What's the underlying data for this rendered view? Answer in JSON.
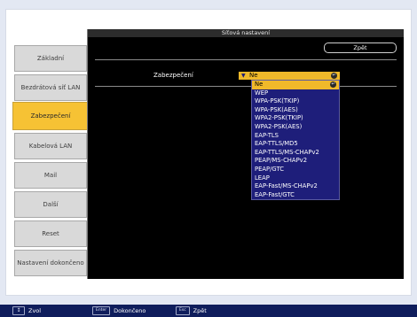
{
  "sidebar": {
    "items": [
      {
        "label": "Základní"
      },
      {
        "label": "Bezdrátová síť LAN"
      },
      {
        "label": "Zabezpečení"
      },
      {
        "label": "Kabelová LAN"
      },
      {
        "label": "Mail"
      },
      {
        "label": "Další"
      },
      {
        "label": "Reset"
      },
      {
        "label": "Nastavení dokončeno"
      }
    ],
    "active_label": "Zabezpečení"
  },
  "panel": {
    "title": "Síťová nastavení",
    "back_label": "Zpět",
    "field_label": "Zabezpečení",
    "selected_value": "Ne",
    "options": [
      "Ne",
      "WEP",
      "WPA-PSK(TKIP)",
      "WPA-PSK(AES)",
      "WPA2-PSK(TKIP)",
      "WPA2-PSK(AES)",
      "EAP-TLS",
      "EAP-TTLS/MD5",
      "EAP-TTLS/MS-CHAPv2",
      "PEAP/MS-CHAPv2",
      "PEAP/GTC",
      "LEAP",
      "EAP-Fast/MS-CHAPv2",
      "EAP-Fast/GTC"
    ]
  },
  "statusbar": {
    "items": [
      {
        "key": "↕",
        "label": "Zvol"
      },
      {
        "key": "Enter",
        "label": "Dokončeno"
      },
      {
        "key": "Esc",
        "label": "Zpět"
      }
    ]
  },
  "colors": {
    "accent": "#f6c234",
    "dropdown_bg": "#1e1e7a",
    "statusbar_bg": "#0f1d5c"
  }
}
